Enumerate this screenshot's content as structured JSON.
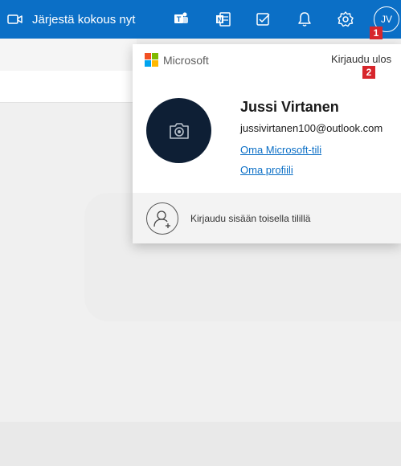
{
  "topbar": {
    "meet_label": "Järjestä kokous nyt",
    "icons": [
      "teams-icon",
      "onenote-icon",
      "todo-icon",
      "bell-icon",
      "gear-icon"
    ],
    "avatar_initials": "JV",
    "background_color": "#0b6fc6"
  },
  "callouts": {
    "first": "1",
    "second": "2",
    "color": "#d7262c"
  },
  "account_card": {
    "brand": "Microsoft",
    "signout_label": "Kirjaudu ulos",
    "name": "Jussi Virtanen",
    "email": "jussivirtanen100@outlook.com",
    "links": [
      "Oma Microsoft-tili",
      "Oma profiili"
    ],
    "other_account_label": "Kirjaudu sisään toisella tilillä"
  },
  "colors": {
    "link": "#0b6fc6",
    "photo_bg": "#0e1f35"
  }
}
